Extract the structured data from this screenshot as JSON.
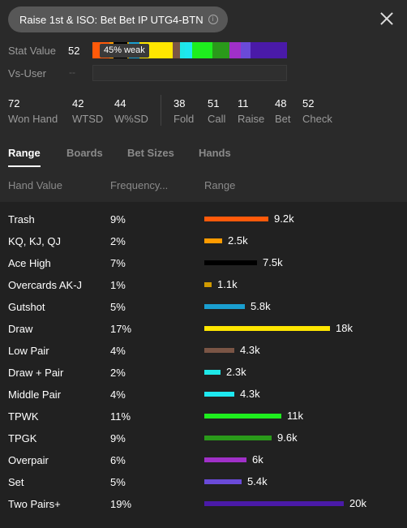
{
  "header": {
    "title": "Raise 1st & ISO: Bet Bet IP UTG4-BTN",
    "info_icon": "info-icon",
    "close_icon": "close-icon"
  },
  "stat_value": {
    "label": "Stat Value",
    "value": "52",
    "badge": "45% weak"
  },
  "vs_user": {
    "label": "Vs-User",
    "value": "--"
  },
  "stats": [
    {
      "value": "72",
      "label": "Won Hand"
    },
    {
      "value": "42",
      "label": "WTSD"
    },
    {
      "value": "44",
      "label": "W%SD"
    },
    {
      "value": "38",
      "label": "Fold"
    },
    {
      "value": "51",
      "label": "Call"
    },
    {
      "value": "11",
      "label": "Raise"
    },
    {
      "value": "48",
      "label": "Bet"
    },
    {
      "value": "52",
      "label": "Check"
    }
  ],
  "tabs": [
    {
      "label": "Range",
      "active": true
    },
    {
      "label": "Boards",
      "active": false
    },
    {
      "label": "Bet Sizes",
      "active": false
    },
    {
      "label": "Hands",
      "active": false
    }
  ],
  "columns": {
    "hand": "Hand Value",
    "freq": "Frequency...",
    "range": "Range"
  },
  "rows": [
    {
      "hand": "Trash",
      "freq": "9%",
      "count": "9.2k",
      "value": 9.2,
      "color": "#ff5a0a"
    },
    {
      "hand": "KQ, KJ, QJ",
      "freq": "2%",
      "count": "2.5k",
      "value": 2.5,
      "color": "#ff9b00"
    },
    {
      "hand": "Ace High",
      "freq": "7%",
      "count": "7.5k",
      "value": 7.5,
      "color": "#000000"
    },
    {
      "hand": "Overcards AK-J",
      "freq": "1%",
      "count": "1.1k",
      "value": 1.1,
      "color": "#d09a00"
    },
    {
      "hand": "Gutshot",
      "freq": "5%",
      "count": "5.8k",
      "value": 5.8,
      "color": "#1a9fd0"
    },
    {
      "hand": "Draw",
      "freq": "17%",
      "count": "18k",
      "value": 18,
      "color": "#ffe600"
    },
    {
      "hand": "Low Pair",
      "freq": "4%",
      "count": "4.3k",
      "value": 4.3,
      "color": "#7a5545"
    },
    {
      "hand": "Draw + Pair",
      "freq": "2%",
      "count": "2.3k",
      "value": 2.3,
      "color": "#1ee8e8"
    },
    {
      "hand": "Middle Pair",
      "freq": "4%",
      "count": "4.3k",
      "value": 4.3,
      "color": "#1ee8f0"
    },
    {
      "hand": "TPWK",
      "freq": "11%",
      "count": "11k",
      "value": 11,
      "color": "#1eee1e"
    },
    {
      "hand": "TPGK",
      "freq": "9%",
      "count": "9.6k",
      "value": 9.6,
      "color": "#2a9a1a"
    },
    {
      "hand": "Overpair",
      "freq": "6%",
      "count": "6k",
      "value": 6,
      "color": "#a030c8"
    },
    {
      "hand": "Set",
      "freq": "5%",
      "count": "5.4k",
      "value": 5.4,
      "color": "#6a4ad8"
    },
    {
      "hand": "Two Pairs+",
      "freq": "19%",
      "count": "20k",
      "value": 20,
      "color": "#4a1aa8"
    }
  ]
}
